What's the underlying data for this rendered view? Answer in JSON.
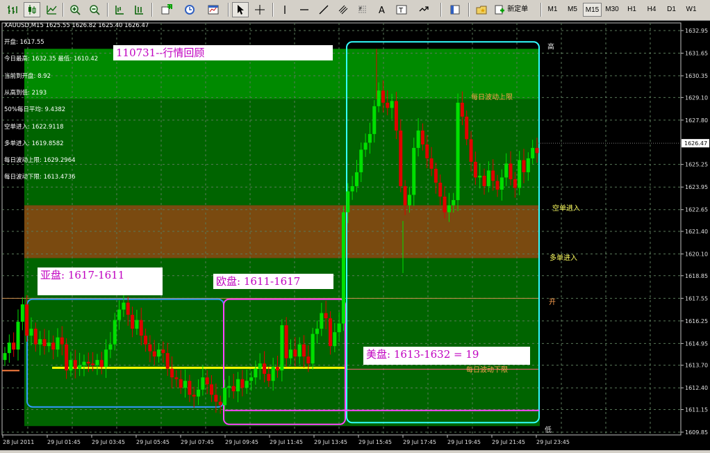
{
  "toolbar": {
    "new_order_label": "新定单",
    "timeframes": [
      "M1",
      "M5",
      "M15",
      "M30",
      "H1",
      "H4",
      "D1",
      "W1"
    ],
    "active_timeframe": "M15"
  },
  "chart": {
    "header": "XAUUSD,M15  1625.55 1626.82 1625.40 1626.47",
    "info_lines": [
      "开盘: 1617.55",
      "今日最高: 1632.35  最低: 1610.42",
      "当前到开盘: 8.92",
      "从高到低: 2193",
      "50%每日平均: 9.4382",
      "空单进入: 1622.9118",
      "多单进入: 1619.8582",
      "每日波动上限: 1629.2964",
      "每日波动下限: 1613.4736"
    ],
    "review_title": "110731--行情回顾",
    "asia_label": "亚盘: 1617-1611",
    "europe_label": "欧盘: 1611-1617",
    "us_label": "美盘: 1613-1632 = 19",
    "annotations": {
      "high": "高",
      "low": "低",
      "open": "开",
      "daily_upper": "每日波动上限",
      "daily_lower": "每日波动下限",
      "short_entry": "空单进入",
      "long_entry": "多单进入"
    },
    "current_price": "1626.47",
    "price_labels": [
      "1632.95",
      "1631.65",
      "1630.35",
      "1629.10",
      "1627.80",
      "1625.25",
      "1623.95",
      "1622.65",
      "1621.40",
      "1620.10",
      "1618.85",
      "1617.55",
      "1616.25",
      "1614.95",
      "1613.70",
      "1612.40",
      "1611.15",
      "1609.85"
    ],
    "time_labels": [
      "28 Jul 2011",
      "29 Jul 01:45",
      "29 Jul 03:45",
      "29 Jul 05:45",
      "29 Jul 07:45",
      "29 Jul 09:45",
      "29 Jul 11:45",
      "29 Jul 13:45",
      "29 Jul 15:45",
      "29 Jul 17:45",
      "29 Jul 19:45",
      "29 Jul 21:45",
      "29 Jul 23:45"
    ],
    "colors": {
      "bull": "#00e000",
      "bear": "#e00000",
      "band_green_dark": "#006000",
      "band_green_light": "#007800",
      "band_brown": "#7a4a10",
      "asia_box": "#3399ff",
      "europe_box": "#ff44ff",
      "us_box": "#33ffff",
      "yellow_line": "#ffff00"
    }
  }
}
